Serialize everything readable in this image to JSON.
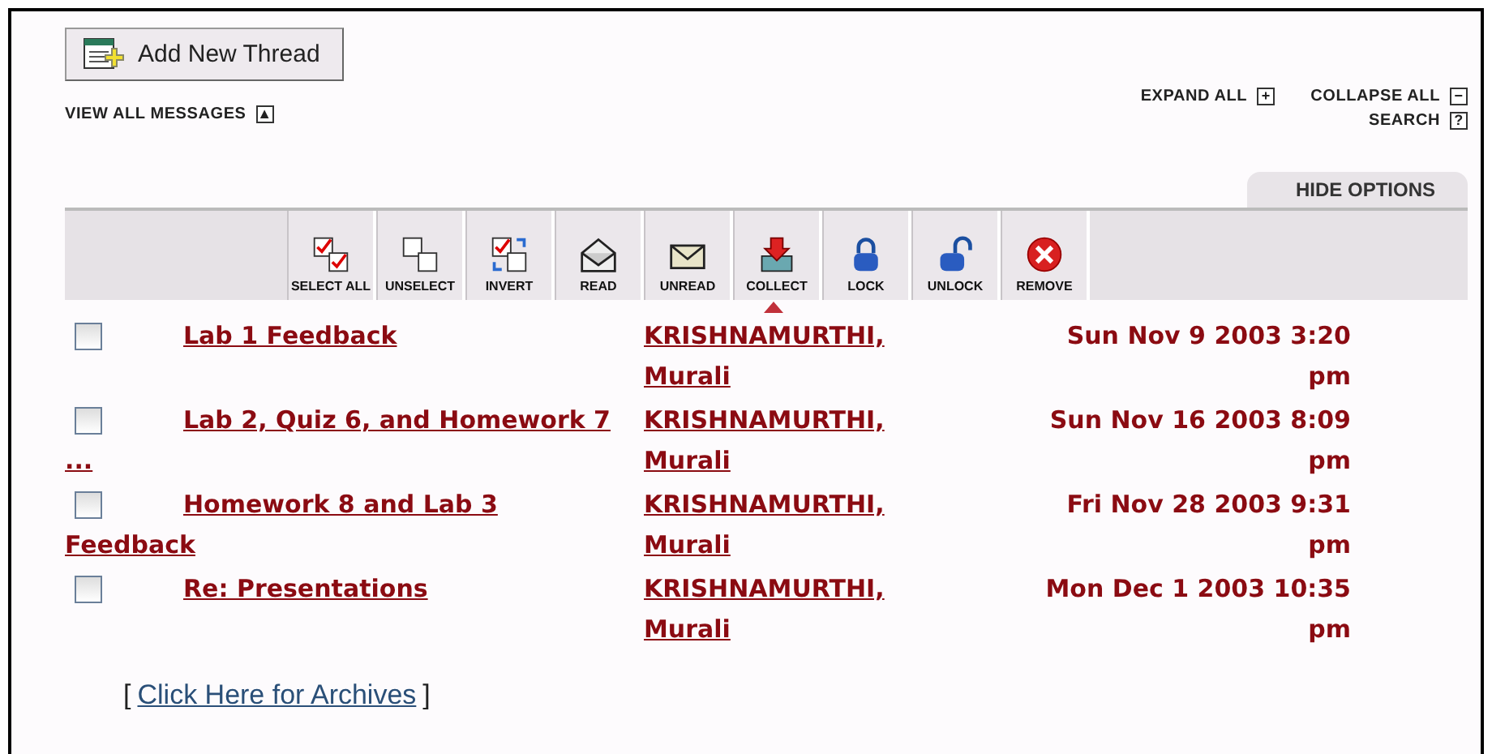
{
  "add_button": {
    "label": "Add New Thread"
  },
  "view_all": {
    "label": "VIEW ALL MESSAGES",
    "icon": "▲"
  },
  "links": [
    {
      "label": "EXPAND ALL",
      "icon": "+"
    },
    {
      "label": "COLLAPSE ALL",
      "icon": "−"
    },
    {
      "label": "SEARCH",
      "icon": "?"
    }
  ],
  "options_tab": {
    "label": "HIDE OPTIONS"
  },
  "toolbar": [
    {
      "kind": "select_all",
      "label": "SELECT ALL"
    },
    {
      "kind": "unselect",
      "label": "UNSELECT"
    },
    {
      "kind": "invert",
      "label": "INVERT"
    },
    {
      "kind": "read",
      "label": "READ"
    },
    {
      "kind": "unread",
      "label": "UNREAD"
    },
    {
      "kind": "collect",
      "label": "COLLECT"
    },
    {
      "kind": "lock",
      "label": "LOCK"
    },
    {
      "kind": "unlock",
      "label": "UNLOCK"
    },
    {
      "kind": "remove",
      "label": "REMOVE"
    }
  ],
  "sorted_by_author": true,
  "threads": [
    {
      "checked": false,
      "subject": "Lab 1 Feedback",
      "author": "KRISHNAMURTHI, Murali",
      "date": "Sun Nov 9 2003 3:20 pm"
    },
    {
      "checked": false,
      "subject": "Lab 2, Quiz 6, and Homework 7 ...",
      "author": "KRISHNAMURTHI, Murali",
      "date": "Sun Nov 16 2003 8:09 pm"
    },
    {
      "checked": false,
      "subject": "Homework 8 and Lab 3 Feedback",
      "author": "KRISHNAMURTHI, Murali",
      "date": "Fri Nov 28 2003 9:31 pm"
    },
    {
      "checked": false,
      "subject": "Re: Presentations",
      "author": "KRISHNAMURTHI, Murali",
      "date": "Mon Dec 1 2003 10:35 pm"
    }
  ],
  "archives": {
    "open": "[",
    "link": "Click Here for Archives",
    "close": "]"
  }
}
